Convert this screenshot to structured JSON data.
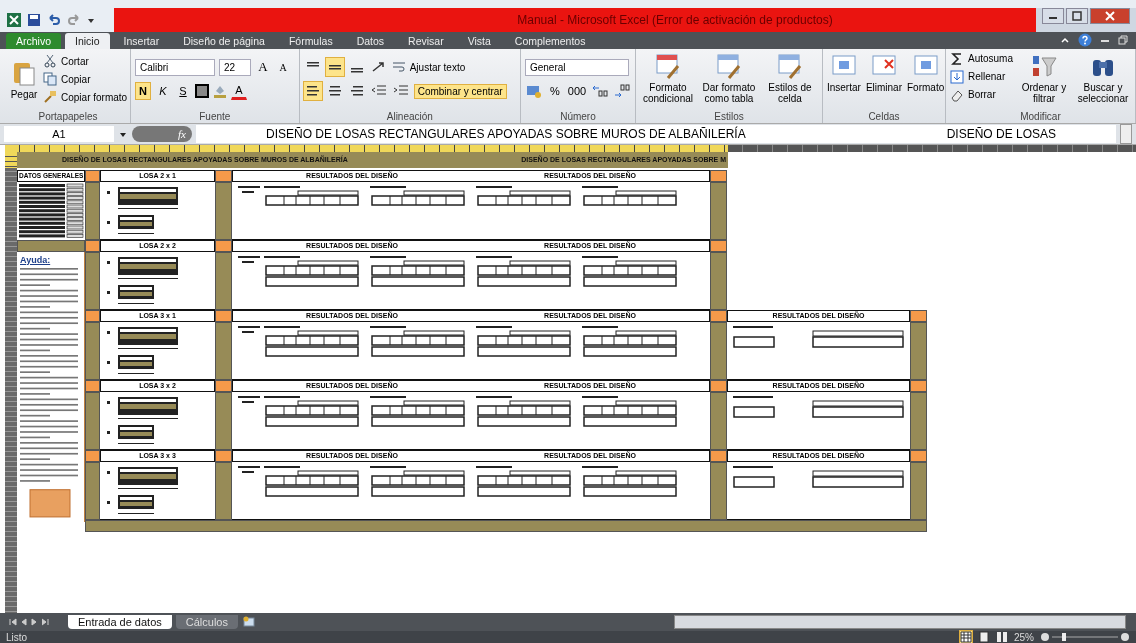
{
  "window": {
    "title": "Manual  -  Microsoft Excel (Error de activación de productos)"
  },
  "tabs": [
    {
      "label": "Archivo",
      "kind": "file",
      "selected": false
    },
    {
      "label": "Inicio",
      "kind": "tab",
      "selected": true
    },
    {
      "label": "Insertar",
      "kind": "tab",
      "selected": false
    },
    {
      "label": "Diseño de página",
      "kind": "tab",
      "selected": false
    },
    {
      "label": "Fórmulas",
      "kind": "tab",
      "selected": false
    },
    {
      "label": "Datos",
      "kind": "tab",
      "selected": false
    },
    {
      "label": "Revisar",
      "kind": "tab",
      "selected": false
    },
    {
      "label": "Vista",
      "kind": "tab",
      "selected": false
    },
    {
      "label": "Complementos",
      "kind": "tab",
      "selected": false
    }
  ],
  "clipboard": {
    "label": "Portapapeles",
    "paste": "Pegar",
    "cut": "Cortar",
    "copy": "Copiar",
    "format_painter": "Copiar formato"
  },
  "font": {
    "label": "Fuente",
    "family": "Calibri",
    "size": "22",
    "grow": "A",
    "shrink": "A",
    "bold": {
      "text": "N",
      "selected": true
    },
    "italic": {
      "text": "K",
      "selected": false
    },
    "underline": {
      "text": "S",
      "selected": false
    },
    "font_color_letter": "A"
  },
  "alignment": {
    "label": "Alineación",
    "vertical": [
      {
        "selected": false
      },
      {
        "selected": true
      },
      {
        "selected": false
      }
    ],
    "horizontal": [
      {
        "selected": true
      },
      {
        "selected": false
      },
      {
        "selected": false
      }
    ],
    "wrap": "Ajustar texto",
    "merge": {
      "text": "Combinar y centrar",
      "selected": true
    }
  },
  "number": {
    "label": "Número",
    "format": "General",
    "percent": "%",
    "thousands": "000"
  },
  "styles": {
    "label": "Estilos",
    "buttons": [
      "Formato condicional",
      "Dar formato como tabla",
      "Estilos de celda"
    ]
  },
  "cells": {
    "label": "Celdas",
    "buttons": [
      "Insertar",
      "Eliminar",
      "Formato"
    ]
  },
  "editing": {
    "label": "Modificar",
    "autosum": "Autosuma",
    "fill": "Rellenar",
    "clear": "Borrar",
    "sort": "Ordenar y filtrar",
    "find": "Buscar y seleccionar"
  },
  "formula_bar": {
    "name_box": "A1",
    "function_label": "fx",
    "formula": "DISEÑO DE LOSAS RECTANGULARES APOYADAS SOBRE MUROS DE ALBAÑILERÍA",
    "formula_tail": "DISEÑO DE LOSAS"
  },
  "sheet": {
    "banner": [
      "DISEÑO DE LOSAS RECTANGULARES APOYADAS SOBRE MUROS DE ALBAÑILERÍA",
      "DISEÑO DE LOSAS RECTANGULARES APOYADAS SOBRE M"
    ],
    "data_title": "DATOS GENERALES",
    "help_title": "Ayuda:",
    "blocks": [
      {
        "title": "LOSA 2 x 1",
        "results": [
          "RESULTADOS DEL DISEÑO",
          "RESULTADOS DEL DISEÑO"
        ]
      },
      {
        "title": "LOSA 2 x 2",
        "results": [
          "RESULTADOS DEL DISEÑO",
          "RESULTADOS DEL DISEÑO"
        ]
      },
      {
        "title": "LOSA 3 x 1",
        "results": [
          "RESULTADOS DEL DISEÑO",
          "RESULTADOS DEL DISEÑO"
        ],
        "extra_result": "RESULTADOS DEL DISEÑO"
      },
      {
        "title": "LOSA 3 x 2",
        "results": [
          "RESULTADOS DEL DISEÑO",
          "RESULTADOS DEL DISEÑO"
        ],
        "extra_result": "RESULTADOS DEL DISEÑO"
      },
      {
        "title": "LOSA 3 x 3",
        "results": [
          "RESULTADOS DEL DISEÑO",
          "RESULTADOS DEL DISEÑO"
        ],
        "extra_result": "RESULTADOS DEL DISEÑO"
      }
    ]
  },
  "sheet_tabs": [
    {
      "label": "Entrada de datos",
      "selected": true
    },
    {
      "label": "Cálculos",
      "selected": false
    }
  ],
  "status_bar": {
    "status": "Listo",
    "zoom": "25%"
  }
}
